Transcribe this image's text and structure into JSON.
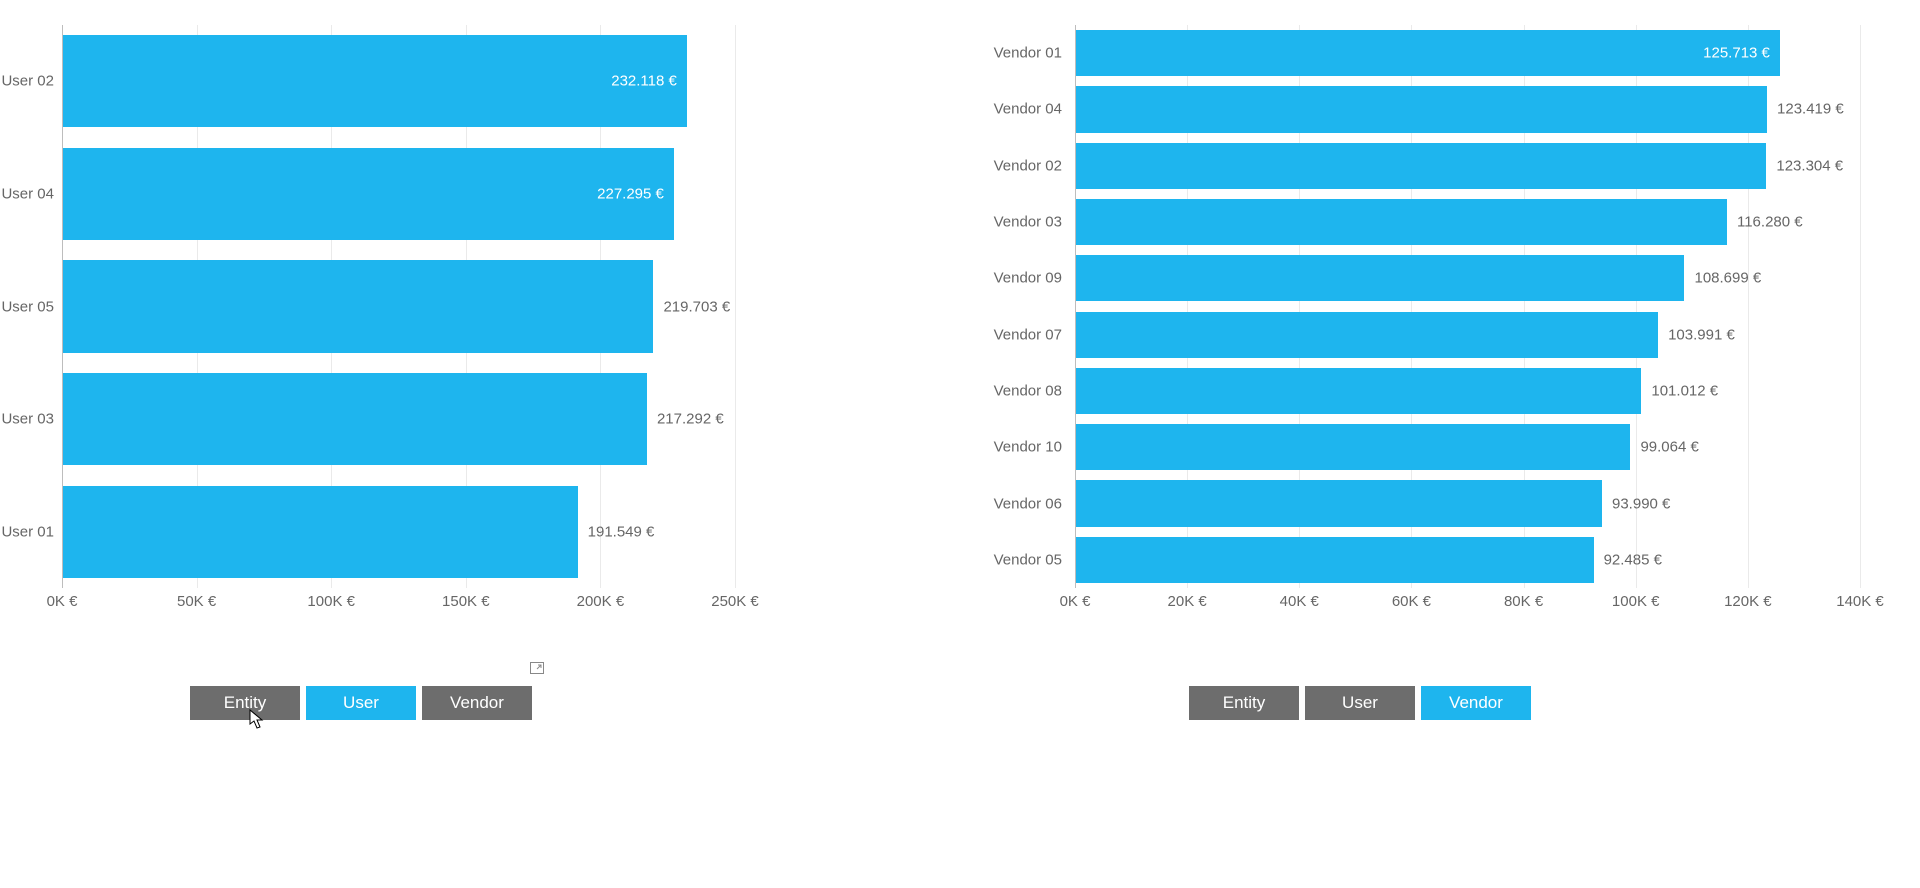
{
  "colors": {
    "bar": "#1eb5ee",
    "grid": "#eaeaea",
    "axis": "#bdbdbd",
    "btn_inactive": "#6d6d6d",
    "btn_active": "#1eb5ee",
    "text": "#666666"
  },
  "left_panel": {
    "buttons": [
      {
        "label": "Entity",
        "active": false,
        "hover": true
      },
      {
        "label": "User",
        "active": true
      },
      {
        "label": "Vendor",
        "active": false
      }
    ]
  },
  "right_panel": {
    "buttons": [
      {
        "label": "Entity",
        "active": false
      },
      {
        "label": "User",
        "active": false
      },
      {
        "label": "Vendor",
        "active": true
      }
    ]
  },
  "chart_data": [
    {
      "type": "bar",
      "orientation": "horizontal",
      "title": "",
      "xlabel": "",
      "ylabel": "",
      "xlim": [
        0,
        250000
      ],
      "xticks": [
        0,
        50000,
        100000,
        150000,
        200000,
        250000
      ],
      "xtick_labels": [
        "0K €",
        "50K €",
        "100K €",
        "150K €",
        "200K €",
        "250K €"
      ],
      "categories": [
        "User 02",
        "User 04",
        "User 05",
        "User 03",
        "User 01"
      ],
      "values": [
        232118,
        227295,
        219703,
        217292,
        191549
      ],
      "value_labels": [
        "232.118 €",
        "227.295 €",
        "219.703 €",
        "217.292 €",
        "191.549 €"
      ],
      "label_inside_threshold": 2
    },
    {
      "type": "bar",
      "orientation": "horizontal",
      "title": "",
      "xlabel": "",
      "ylabel": "",
      "xlim": [
        0,
        140000
      ],
      "xticks": [
        0,
        20000,
        40000,
        60000,
        80000,
        100000,
        120000,
        140000
      ],
      "xtick_labels": [
        "0K €",
        "20K €",
        "40K €",
        "60K €",
        "80K €",
        "100K €",
        "120K €",
        "140K €"
      ],
      "categories": [
        "Vendor 01",
        "Vendor 04",
        "Vendor 02",
        "Vendor 03",
        "Vendor 09",
        "Vendor 07",
        "Vendor 08",
        "Vendor 10",
        "Vendor 06",
        "Vendor 05"
      ],
      "values": [
        125713,
        123419,
        123304,
        116280,
        108699,
        103991,
        101012,
        99064,
        93990,
        92485
      ],
      "value_labels": [
        "125.713 €",
        "123.419 €",
        "123.304 €",
        "116.280 €",
        "108.699 €",
        "103.991 €",
        "101.012 €",
        "99.064 €",
        "93.990 €",
        "92.485 €"
      ],
      "label_inside_threshold": 1
    }
  ]
}
